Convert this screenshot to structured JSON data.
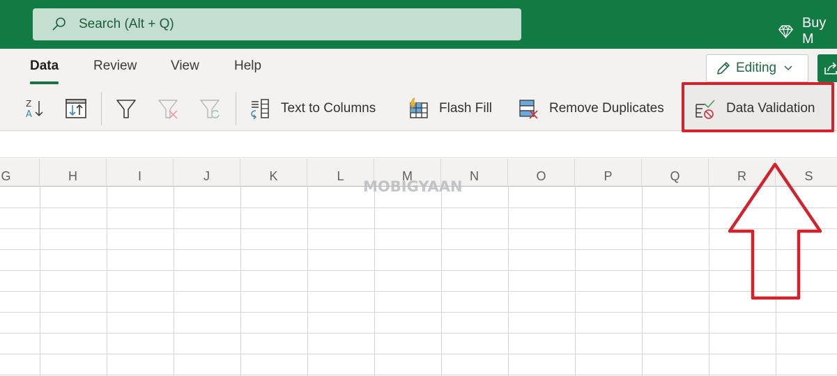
{
  "titlebar": {
    "search_placeholder": "Search (Alt + Q)",
    "search_icon": "search-icon",
    "buy_label": "Buy M",
    "buy_icon": "diamond-icon",
    "brand_color": "#117b43"
  },
  "ribbon": {
    "tabs": [
      {
        "label": "Data",
        "active": true
      },
      {
        "label": "Review",
        "active": false
      },
      {
        "label": "View",
        "active": false
      },
      {
        "label": "Help",
        "active": false
      }
    ],
    "mode_button": {
      "label": "Editing",
      "icon": "pencil-icon"
    },
    "share_icon": "share-icon",
    "toolbar": [
      {
        "name": "sort-z-to-a",
        "icon": "sort-z-a-icon",
        "label": ""
      },
      {
        "name": "custom-sort",
        "icon": "custom-sort-icon",
        "label": ""
      },
      {
        "name": "filter",
        "icon": "filter-icon",
        "label": ""
      },
      {
        "name": "clear-filter",
        "icon": "clear-filter-icon",
        "label": ""
      },
      {
        "name": "reapply-filter",
        "icon": "reapply-filter-icon",
        "label": ""
      },
      {
        "name": "text-to-columns",
        "icon": "text-to-columns-icon",
        "label": "Text to Columns"
      },
      {
        "name": "flash-fill",
        "icon": "flash-fill-icon",
        "label": "Flash Fill"
      },
      {
        "name": "remove-duplicates",
        "icon": "remove-duplicates-icon",
        "label": "Remove Duplicates"
      },
      {
        "name": "data-validation",
        "icon": "data-validation-icon",
        "label": "Data Validation",
        "highlighted": true
      }
    ]
  },
  "sheet": {
    "columns": [
      "G",
      "H",
      "I",
      "J",
      "K",
      "L",
      "M",
      "N",
      "O",
      "P",
      "Q",
      "R",
      "S"
    ]
  },
  "annotation": {
    "highlight_color": "#d0232e",
    "target": "Data Validation",
    "watermark": "MOBIGYAAN"
  }
}
